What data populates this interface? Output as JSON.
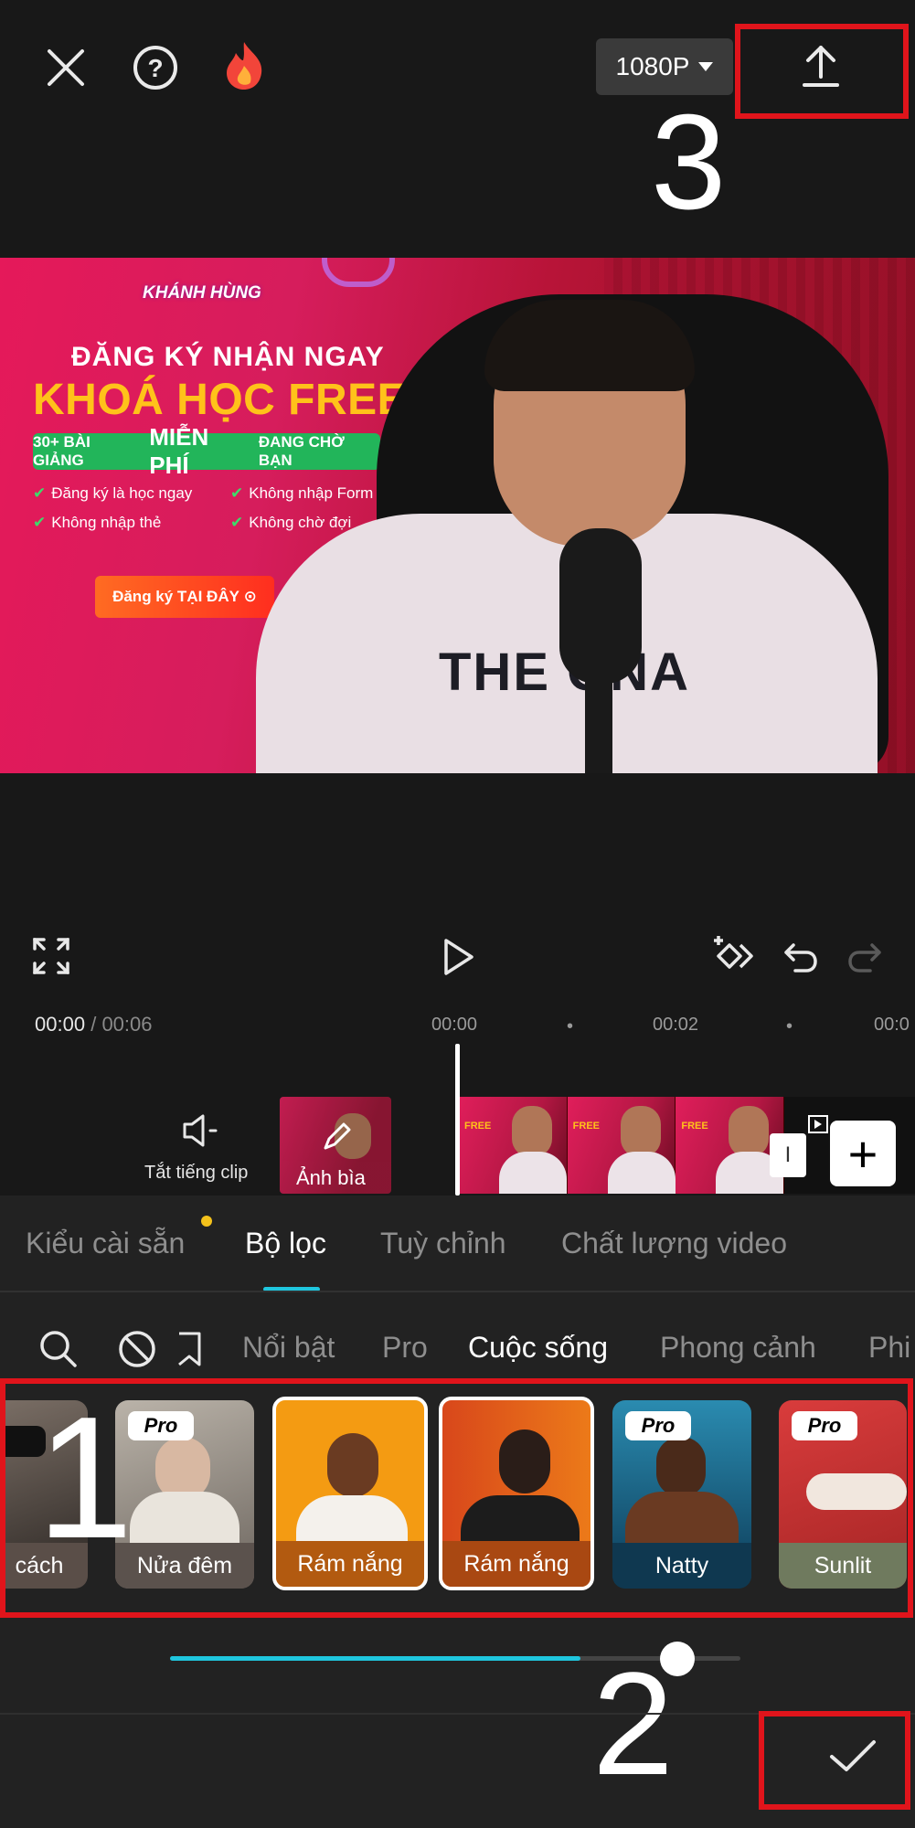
{
  "toolbar": {
    "resolution": "1080P",
    "annotation_3": "3"
  },
  "preview": {
    "logo": "KHÁNH HÙNG",
    "headline1": "ĐĂNG KÝ NHẬN NGAY",
    "headline2": "KHOÁ HỌC FREE",
    "pill_pre": "30+ BÀI GIẢNG",
    "pill_big": "MIỄN PHÍ",
    "pill_post": "ĐANG CHỜ BẠN",
    "checks": [
      "Đăng ký là học ngay",
      "Không nhập Form",
      "Không nhập thẻ",
      "Không chờ đợi"
    ],
    "cta": "Đăng ký TẠI ĐÂY",
    "hoodie": "THE  ONA"
  },
  "timeline": {
    "current_time": "00:00",
    "separator": "/",
    "total_time": "00:06",
    "ruler": [
      "00:00",
      "00:02",
      "00:0"
    ],
    "mute_label": "Tắt tiếng clip",
    "cover_label": "Ảnh bìa"
  },
  "tabs": [
    {
      "label": "Kiểu cài sẵn"
    },
    {
      "label": "Bộ lọc"
    },
    {
      "label": "Tuỳ chỉnh"
    },
    {
      "label": "Chất lượng video"
    }
  ],
  "categories": [
    {
      "label": "Nổi bật"
    },
    {
      "label": "Pro"
    },
    {
      "label": "Cuộc sống"
    },
    {
      "label": "Phong cảnh"
    },
    {
      "label": "Phi"
    }
  ],
  "filters": [
    {
      "label": "cách"
    },
    {
      "label": "Nửa đêm",
      "badge": "Pro"
    },
    {
      "label": "Rám nắng"
    },
    {
      "label": "Rám nắng"
    },
    {
      "label": "Natty",
      "badge": "Pro"
    },
    {
      "label": "Sunlit",
      "badge": "Pro"
    }
  ],
  "annotations": {
    "one": "1",
    "two": "2"
  },
  "slider": {
    "value": 0.72
  },
  "colors": {
    "accent": "#1fc6de",
    "highlight_box": "#e0141b",
    "dot": "#f4c21b"
  }
}
